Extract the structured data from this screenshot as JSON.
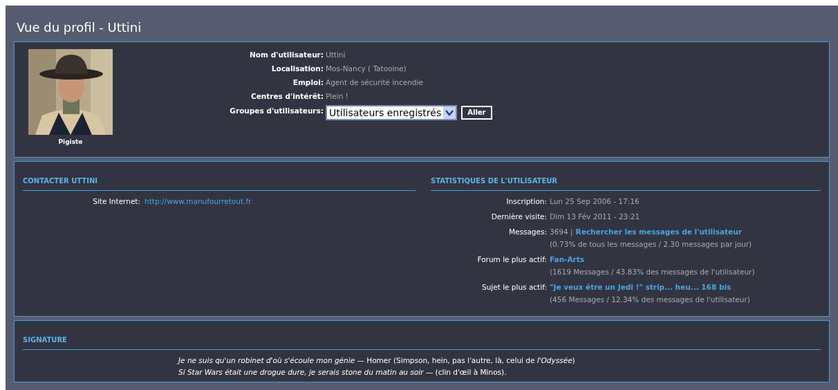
{
  "page_title": "Vue du profil - Uttini",
  "profile": {
    "rank": "Pigiste",
    "fields": [
      {
        "label": "Nom d'utilisateur:",
        "value": "Uttini"
      },
      {
        "label": "Localisation:",
        "value": "Mos-Nancy ( Tatooine)"
      },
      {
        "label": "Emploi:",
        "value": "Agent de sécurité incendie"
      },
      {
        "label": "Centres d'intérêt:",
        "value": "Plein !"
      }
    ],
    "groups": {
      "label": "Groupes d'utilisateurs:",
      "value": "Utilisateurs enregistrés",
      "button": "Aller"
    }
  },
  "contact": {
    "title": "CONTACTER UTTINI",
    "rows": [
      {
        "label": "Site Internet:",
        "link": "http://www.manufourretout.fr"
      }
    ]
  },
  "stats": {
    "title": "STATISTIQUES DE L'UTILISATEUR",
    "rows": [
      {
        "label": "Inscription:",
        "value": "Lun 25 Sep 2006 - 17:16"
      },
      {
        "label": "Dernière visite:",
        "value": "Dim 13 Fév 2011 - 23:21"
      },
      {
        "label": "Messages:",
        "value": "3694 |",
        "link": "Rechercher les messages de l'utilisateur",
        "note": "(0.73% de tous les messages / 2.30 messages par jour)"
      },
      {
        "label": "Forum le plus actif:",
        "link": "Fan-Arts",
        "note": "(1619 Messages / 43.83% des messages de l'utilisateur)"
      },
      {
        "label": "Sujet le plus actif:",
        "link": "\"Je veux être un Jedi !\" strip... heu... 168 bis",
        "note": "(456 Messages / 12.34% des messages de l'utilisateur)"
      }
    ]
  },
  "signature": {
    "title": "SIGNATURE",
    "lines": [
      "*Je ne suis qu'un robinet d'où s'écoule mon génie* — Homer (Simpson, hein, pas l'autre, là, celui de *l'Odyssée*)",
      "*Si Star Wars était une drogue dure, je serais stone du matin au soir* — (clin d'œil à Minos)."
    ]
  }
}
